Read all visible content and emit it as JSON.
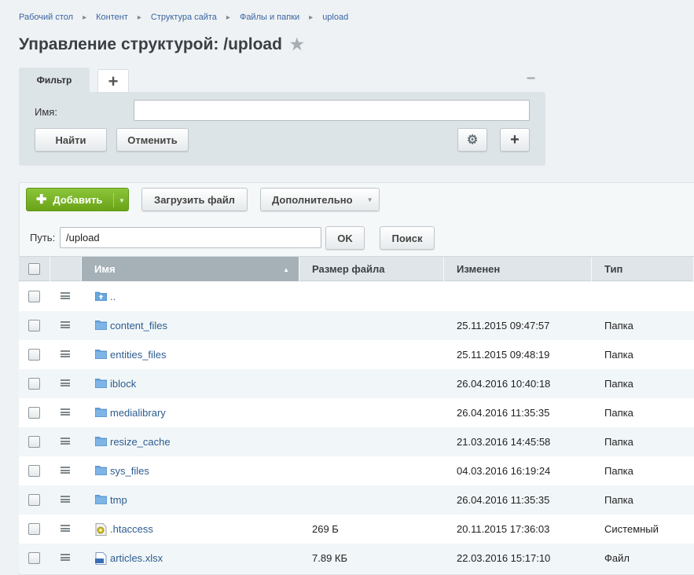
{
  "breadcrumbs": [
    "Рабочий стол",
    "Контент",
    "Структура сайта",
    "Файлы и папки",
    "upload"
  ],
  "page_title": "Управление структурой: /upload",
  "filter": {
    "tab_label": "Фильтр",
    "add_tab_label": "+",
    "name_label": "Имя:",
    "name_value": "",
    "find_label": "Найти",
    "cancel_label": "Отменить",
    "add_field_label": "+"
  },
  "toolbar": {
    "add_label": "Добавить",
    "upload_label": "Загрузить файл",
    "more_label": "Дополнительно"
  },
  "path": {
    "label": "Путь:",
    "value": "/upload",
    "ok_label": "OK",
    "search_label": "Поиск"
  },
  "table": {
    "columns": [
      "Имя",
      "Размер файла",
      "Изменен",
      "Тип"
    ],
    "rows": [
      {
        "name": "..",
        "size": "",
        "date": "",
        "type": "",
        "icon": "folder-up-icon"
      },
      {
        "name": "content_files",
        "size": "",
        "date": "25.11.2015 09:47:57",
        "type": "Папка",
        "icon": "folder-icon"
      },
      {
        "name": "entities_files",
        "size": "",
        "date": "25.11.2015 09:48:19",
        "type": "Папка",
        "icon": "folder-icon"
      },
      {
        "name": "iblock",
        "size": "",
        "date": "26.04.2016 10:40:18",
        "type": "Папка",
        "icon": "folder-icon"
      },
      {
        "name": "medialibrary",
        "size": "",
        "date": "26.04.2016 11:35:35",
        "type": "Папка",
        "icon": "folder-icon"
      },
      {
        "name": "resize_cache",
        "size": "",
        "date": "21.03.2016 14:45:58",
        "type": "Папка",
        "icon": "folder-icon"
      },
      {
        "name": "sys_files",
        "size": "",
        "date": "04.03.2016 16:19:24",
        "type": "Папка",
        "icon": "folder-icon"
      },
      {
        "name": "tmp",
        "size": "",
        "date": "26.04.2016 11:35:35",
        "type": "Папка",
        "icon": "folder-icon"
      },
      {
        "name": ".htaccess",
        "size": "269 Б",
        "date": "20.11.2015 17:36:03",
        "type": "Системный",
        "icon": "system-file-icon"
      },
      {
        "name": "articles.xlsx",
        "size": "7.89 КБ",
        "date": "22.03.2016 15:17:10",
        "type": "Файл",
        "icon": "file-icon"
      }
    ]
  },
  "colors": {
    "accent_green": "#7bb52a",
    "link_blue": "#2d5c8f",
    "folder_blue": "#5d9ad6"
  }
}
